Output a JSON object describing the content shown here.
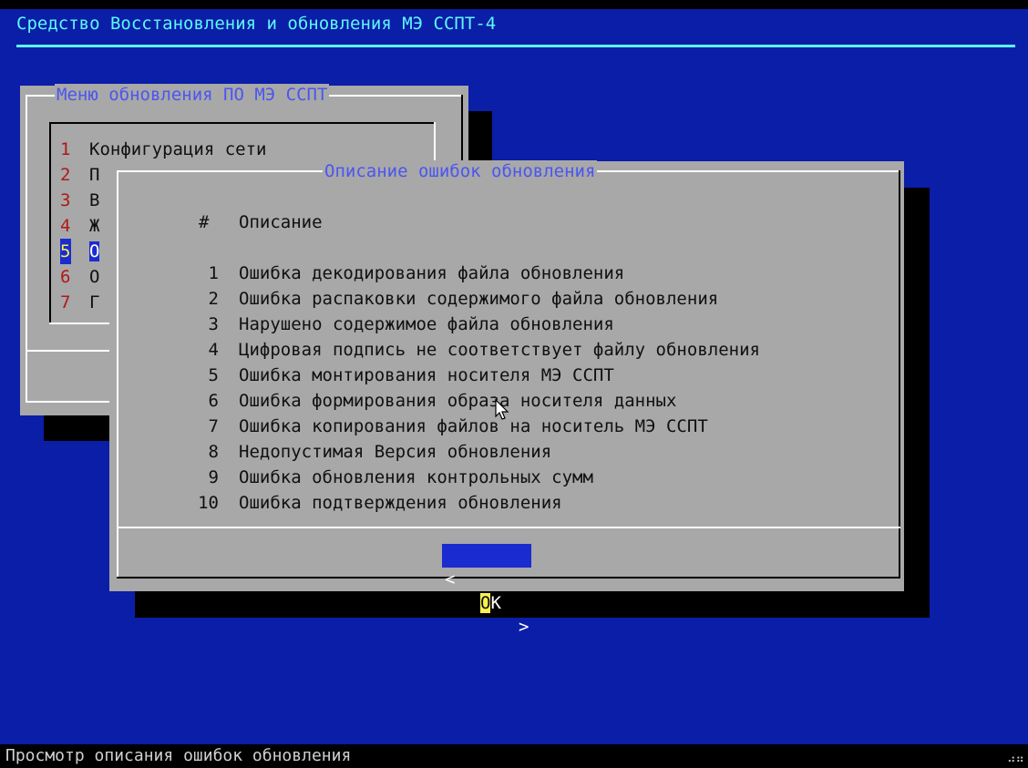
{
  "backtitle": "Средство Восстановления и обновления МЭ ССПТ-4",
  "status_text": "Просмотр описания ошибок обновления",
  "menu_dialog": {
    "title": "Меню обновления ПО МЭ ССПТ",
    "items": [
      {
        "num": "1",
        "label": "Конфигурация сети"
      },
      {
        "num": "2",
        "label": "П"
      },
      {
        "num": "3",
        "label": "В"
      },
      {
        "num": "4",
        "label": "Ж"
      },
      {
        "num": "5",
        "label": "О"
      },
      {
        "num": "6",
        "label": "О"
      },
      {
        "num": "7",
        "label": "Г"
      }
    ],
    "selected_index": 4
  },
  "error_dialog": {
    "title": "Описание ошибок обновления",
    "header_num": "#",
    "header_desc": "Описание",
    "rows": [
      {
        "num": "1",
        "desc": "Ошибка декодирования файла обновления"
      },
      {
        "num": "2",
        "desc": "Ошибка распаковки содержимого файла обновления"
      },
      {
        "num": "3",
        "desc": "Нарушено содержимое файла обновления"
      },
      {
        "num": "4",
        "desc": "Цифровая подпись не соответствует файлу обновления"
      },
      {
        "num": "5",
        "desc": "Ошибка монтирования носителя МЭ ССПТ"
      },
      {
        "num": "6",
        "desc": "Ошибка формирования образа носителя данных"
      },
      {
        "num": "7",
        "desc": "Ошибка копирования файлов на носитель МЭ ССПТ"
      },
      {
        "num": "8",
        "desc": "Недопустимая Версия обновления"
      },
      {
        "num": "9",
        "desc": "Ошибка обновления контрольных сумм"
      },
      {
        "num": "10",
        "desc": "Ошибка подтверждения обновления"
      }
    ],
    "ok_button": {
      "left": "<",
      "hotkey": "O",
      "rest": "K",
      "right": ">"
    }
  },
  "colors": {
    "screen_bg": "#0a1ea8",
    "dialog_bg": "#a8a8a8",
    "title_text": "#4a56f0",
    "backtitle": "#5ff8f8",
    "selected_bg": "#1a2cd0",
    "hotkey": "#f8f050",
    "menu_number": "#b01818"
  }
}
